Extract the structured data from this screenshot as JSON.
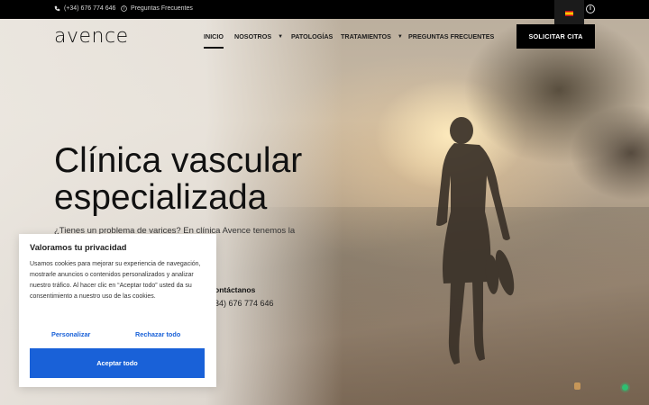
{
  "topbar": {
    "phone": "(+34) 676 774 646",
    "faq": "Preguntas Frecuentes",
    "language_flag": "es-flag",
    "info_icon": "info-circle-icon"
  },
  "header": {
    "logo": "avence",
    "nav": [
      {
        "label": "INICIO",
        "active": true
      },
      {
        "label": "NOSOTROS",
        "dropdown": true
      },
      {
        "label": "PATOLOGÍAS"
      },
      {
        "label": "TRATAMIENTOS",
        "dropdown": true
      },
      {
        "label": "PREGUNTAS FRECUENTES"
      }
    ],
    "cta": "SOLICITAR CITA"
  },
  "hero": {
    "title_line1": "Clínica vascular",
    "title_line2": "especializada",
    "subtitle": "¿Tienes un problema de varices?  En clínica Avence tenemos la",
    "contact_label": "ontáctanos",
    "contact_phone": "34) 676 774 646"
  },
  "cookie": {
    "title": "Valoramos tu privacidad",
    "body": "Usamos cookies para mejorar su experiencia de navegación, mostrarle anuncios o contenidos personalizados y analizar nuestro tráfico. Al hacer clic en “Aceptar todo” usted da su consentimiento a nuestro uso de las cookies.",
    "customize": "Personalizar",
    "reject": "Rechazar todo",
    "accept": "Aceptar todo"
  },
  "colors": {
    "accent_blue": "#1961d8",
    "topbar_bg": "#000000",
    "cta_bg": "#000000"
  }
}
